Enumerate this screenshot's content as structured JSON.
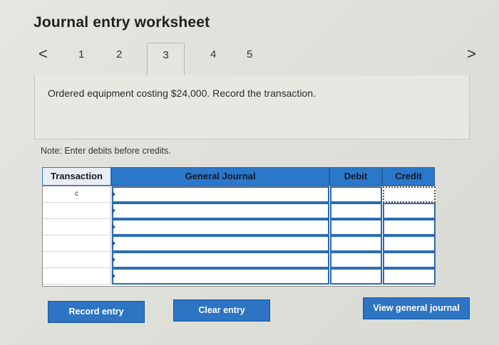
{
  "header": {
    "title": "Journal entry worksheet"
  },
  "tabs": {
    "prev_arrow": "<",
    "next_arrow": ">",
    "items": [
      {
        "label": "1"
      },
      {
        "label": "2"
      },
      {
        "label": "3",
        "active": true
      },
      {
        "label": "4"
      },
      {
        "label": "5"
      }
    ]
  },
  "question": {
    "text": "Ordered equipment costing $24,000. Record the transaction."
  },
  "note": "Note: Enter debits before credits.",
  "table": {
    "headers": {
      "transaction": "Transaction",
      "general_journal": "General Journal",
      "debit": "Debit",
      "credit": "Credit"
    },
    "rows": [
      {
        "transaction": "c",
        "account": "",
        "debit": "",
        "credit": ""
      },
      {
        "transaction": "",
        "account": "",
        "debit": "",
        "credit": ""
      },
      {
        "transaction": "",
        "account": "",
        "debit": "",
        "credit": ""
      },
      {
        "transaction": "",
        "account": "",
        "debit": "",
        "credit": ""
      },
      {
        "transaction": "",
        "account": "",
        "debit": "",
        "credit": ""
      },
      {
        "transaction": "",
        "account": "",
        "debit": "",
        "credit": ""
      }
    ]
  },
  "buttons": {
    "record": "Record entry",
    "clear": "Clear entry",
    "view": "View general journal"
  },
  "colors": {
    "accent": "#2b77c9",
    "button": "#2d74c3"
  }
}
